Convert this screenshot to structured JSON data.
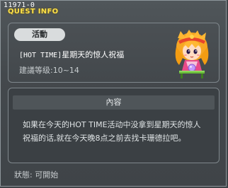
{
  "window": {
    "quest_id": "11971-0",
    "title": "QUEST INFO"
  },
  "quest": {
    "category": "活動",
    "name_prefix": "[HOT TIME]",
    "name": "星期天的惊人祝福",
    "recommended_level": "建議等级:10~14",
    "npc_icon": "npc-girl-portrait"
  },
  "details": {
    "header": "內容",
    "line1": "如果在今天的HOT TIME活动中没拿到星期天的惊人",
    "line2": "祝福的话,就在今天晚8点之前去找卡珊德拉吧。"
  },
  "status": {
    "text": "狀態: 可開始"
  },
  "colors": {
    "title": "#ffe34a",
    "background": "#44494d",
    "badge": "#d9dcdd"
  }
}
